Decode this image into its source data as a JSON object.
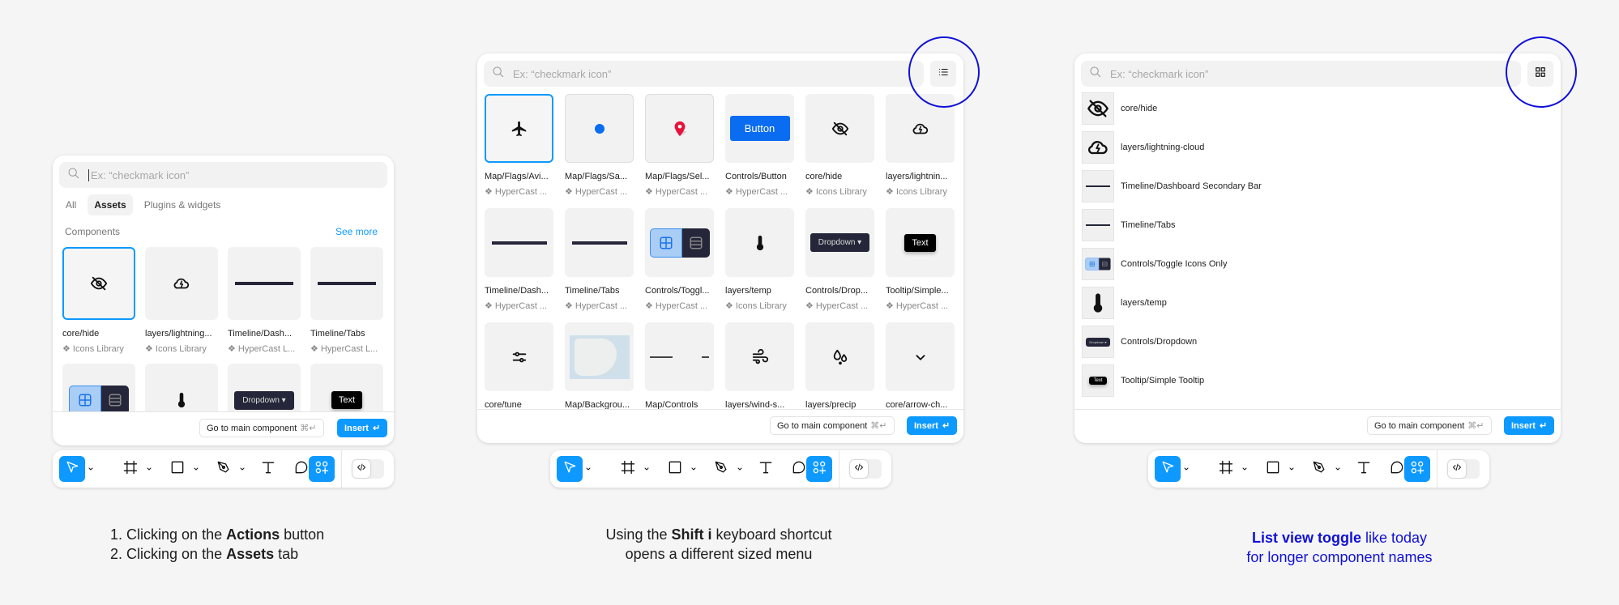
{
  "colors": {
    "accent": "#0d99ff",
    "annotation": "#1010d8",
    "button_blue": "#0a6cf0",
    "dark": "#252639"
  },
  "search_placeholder": "Ex: “checkmark icon”",
  "footer": {
    "go_to": "Go to main component",
    "go_to_shortcut": "⌘↵",
    "insert": "Insert",
    "insert_shortcut": "↵"
  },
  "toolbar": {
    "items": [
      {
        "icon": "move-icon",
        "active": true,
        "chevron": true
      },
      {
        "icon": "frame-icon",
        "chevron": true
      },
      {
        "icon": "rectangle-icon",
        "chevron": true
      },
      {
        "icon": "pen-icon",
        "chevron": true
      },
      {
        "icon": "text-icon"
      },
      {
        "icon": "comment-icon"
      },
      {
        "icon": "actions-icon",
        "active": true
      }
    ],
    "dev_mode_toggle": "code-icon"
  },
  "panel1": {
    "tabs": [
      {
        "label": "All"
      },
      {
        "label": "Assets",
        "active": true
      },
      {
        "label": "Plugins & widgets"
      }
    ],
    "section": "Components",
    "see_more": "See more",
    "tiles": [
      {
        "name": "core/hide",
        "lib": "Icons Library",
        "thumb": "hide",
        "selected": true
      },
      {
        "name": "layers/lightning...",
        "lib": "Icons Library",
        "thumb": "cloud"
      },
      {
        "name": "Timeline/Dash...",
        "lib": "HyperCast L...",
        "thumb": "line"
      },
      {
        "name": "Timeline/Tabs",
        "lib": "HyperCast L...",
        "thumb": "line"
      },
      {
        "thumb": "toggle"
      },
      {
        "thumb": "temp"
      },
      {
        "thumb": "dropdown",
        "text": "Dropdown"
      },
      {
        "thumb": "tooltip",
        "text": "Text"
      }
    ]
  },
  "panel2": {
    "view_toggle": "list-view-icon",
    "tiles": [
      {
        "name": "Map/Flags/Avi...",
        "lib": "HyperCast ...",
        "thumb": "plane",
        "selected": true
      },
      {
        "name": "Map/Flags/Sa...",
        "lib": "HyperCast ...",
        "thumb": "dot",
        "bordered": true
      },
      {
        "name": "Map/Flags/Sel...",
        "lib": "HyperCast ...",
        "thumb": "pin",
        "bordered": true
      },
      {
        "name": "Controls/Button",
        "lib": "HyperCast ...",
        "thumb": "button",
        "text": "Button"
      },
      {
        "name": "core/hide",
        "lib": "Icons Library",
        "thumb": "hide"
      },
      {
        "name": "layers/lightnin...",
        "lib": "Icons Library",
        "thumb": "cloud"
      },
      {
        "name": "Timeline/Dash...",
        "lib": "HyperCast ...",
        "thumb": "line"
      },
      {
        "name": "Timeline/Tabs",
        "lib": "HyperCast ...",
        "thumb": "line"
      },
      {
        "name": "Controls/Toggl...",
        "lib": "HyperCast ...",
        "thumb": "toggle"
      },
      {
        "name": "layers/temp",
        "lib": "Icons Library",
        "thumb": "temp"
      },
      {
        "name": "Controls/Drop...",
        "lib": "HyperCast ...",
        "thumb": "dropdown",
        "text": "Dropdown"
      },
      {
        "name": "Tooltip/Simple...",
        "lib": "HyperCast ...",
        "thumb": "tooltip",
        "text": "Text"
      },
      {
        "name": "core/tune",
        "thumb": "tune"
      },
      {
        "name": "Map/Backgrou...",
        "thumb": "map"
      },
      {
        "name": "Map/Controls",
        "thumb": "controls"
      },
      {
        "name": "layers/wind-s...",
        "thumb": "wind"
      },
      {
        "name": "layers/precip",
        "thumb": "precip"
      },
      {
        "name": "core/arrow-ch...",
        "thumb": "chevron"
      }
    ]
  },
  "panel3": {
    "view_toggle": "grid-view-icon",
    "rows": [
      {
        "name": "core/hide",
        "thumb": "hide"
      },
      {
        "name": "layers/lightning-cloud",
        "thumb": "cloud"
      },
      {
        "name": "Timeline/Dashboard Secondary Bar",
        "thumb": "line"
      },
      {
        "name": "Timeline/Tabs",
        "thumb": "line"
      },
      {
        "name": "Controls/Toggle Icons Only",
        "thumb": "toggle"
      },
      {
        "name": "layers/temp",
        "thumb": "temp"
      },
      {
        "name": "Controls/Dropdown",
        "thumb": "dropdown",
        "text": "Dropdown"
      },
      {
        "name": "Tooltip/Simple Tooltip",
        "thumb": "tooltip",
        "text": "Text"
      }
    ]
  },
  "captions": {
    "c1": {
      "l1_num": "1.",
      "l1_pre": "Clicking on the ",
      "l1_bold": "Actions",
      "l1_post": " button",
      "l2_num": "2.",
      "l2_pre": "Clicking on the ",
      "l2_bold": "Assets",
      "l2_post": " tab"
    },
    "c2": {
      "pre": "Using the ",
      "bold": "Shift i",
      "post": " keyboard shortcut",
      "l2": "opens a different sized menu"
    },
    "c3": {
      "bold": "List view toggle",
      "post": " like today",
      "l2": "for longer component names"
    }
  }
}
